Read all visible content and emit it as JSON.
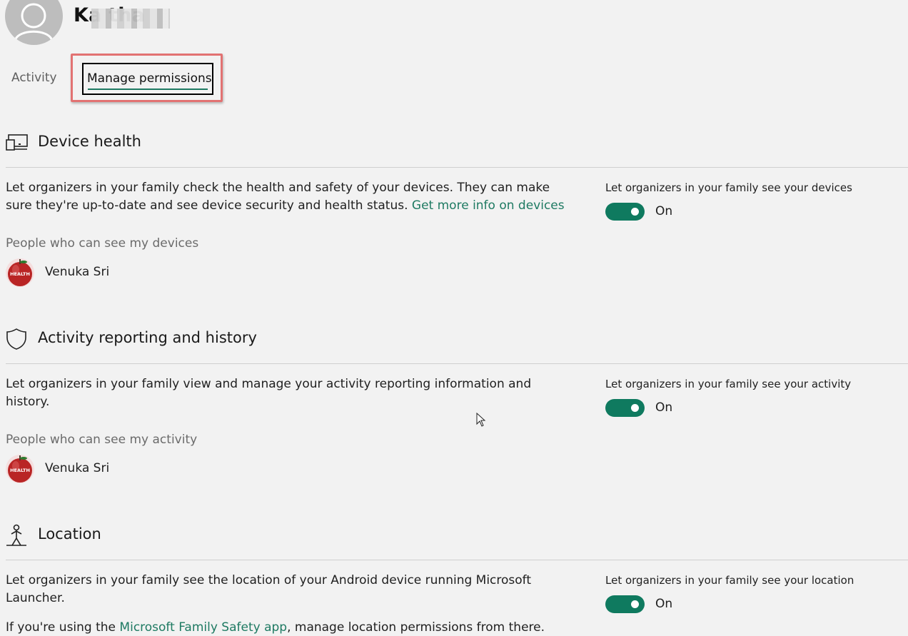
{
  "header": {
    "user_name": "Ka          tha"
  },
  "tabs": {
    "activity": "Activity",
    "manage_permissions": "Manage permissions"
  },
  "device_health": {
    "title": "Device health",
    "desc_text": "Let organizers in your family check the health and safety of your devices. They can make sure they're up-to-date and see device security and health status. ",
    "desc_link": "Get more info on devices",
    "people_label": "People who can see my devices",
    "person_name": "Venuka Sri",
    "toggle_label": "Let organizers in your family see your devices",
    "toggle_state": "On"
  },
  "activity_reporting": {
    "title": "Activity reporting and history",
    "desc_text": "Let organizers in your family view and manage your activity reporting information and history.",
    "people_label": "People who can see my activity",
    "person_name": "Venuka Sri",
    "toggle_label": "Let organizers in your family see your activity",
    "toggle_state": "On"
  },
  "location": {
    "title": "Location",
    "desc_text": "Let organizers in your family see the location of your Android device running Microsoft Launcher.",
    "note_prefix": "If you're using the ",
    "note_link": "Microsoft Family Safety app",
    "note_suffix": ", manage location permissions from there.",
    "toggle_label": "Let organizers in your family see your location",
    "toggle_state": "On"
  },
  "avatar_badge_text": "HEALTH",
  "colors": {
    "accent": "#0f7a5f",
    "link": "#1e7a62",
    "highlight": "#e27272",
    "background": "#f2f2f2"
  }
}
